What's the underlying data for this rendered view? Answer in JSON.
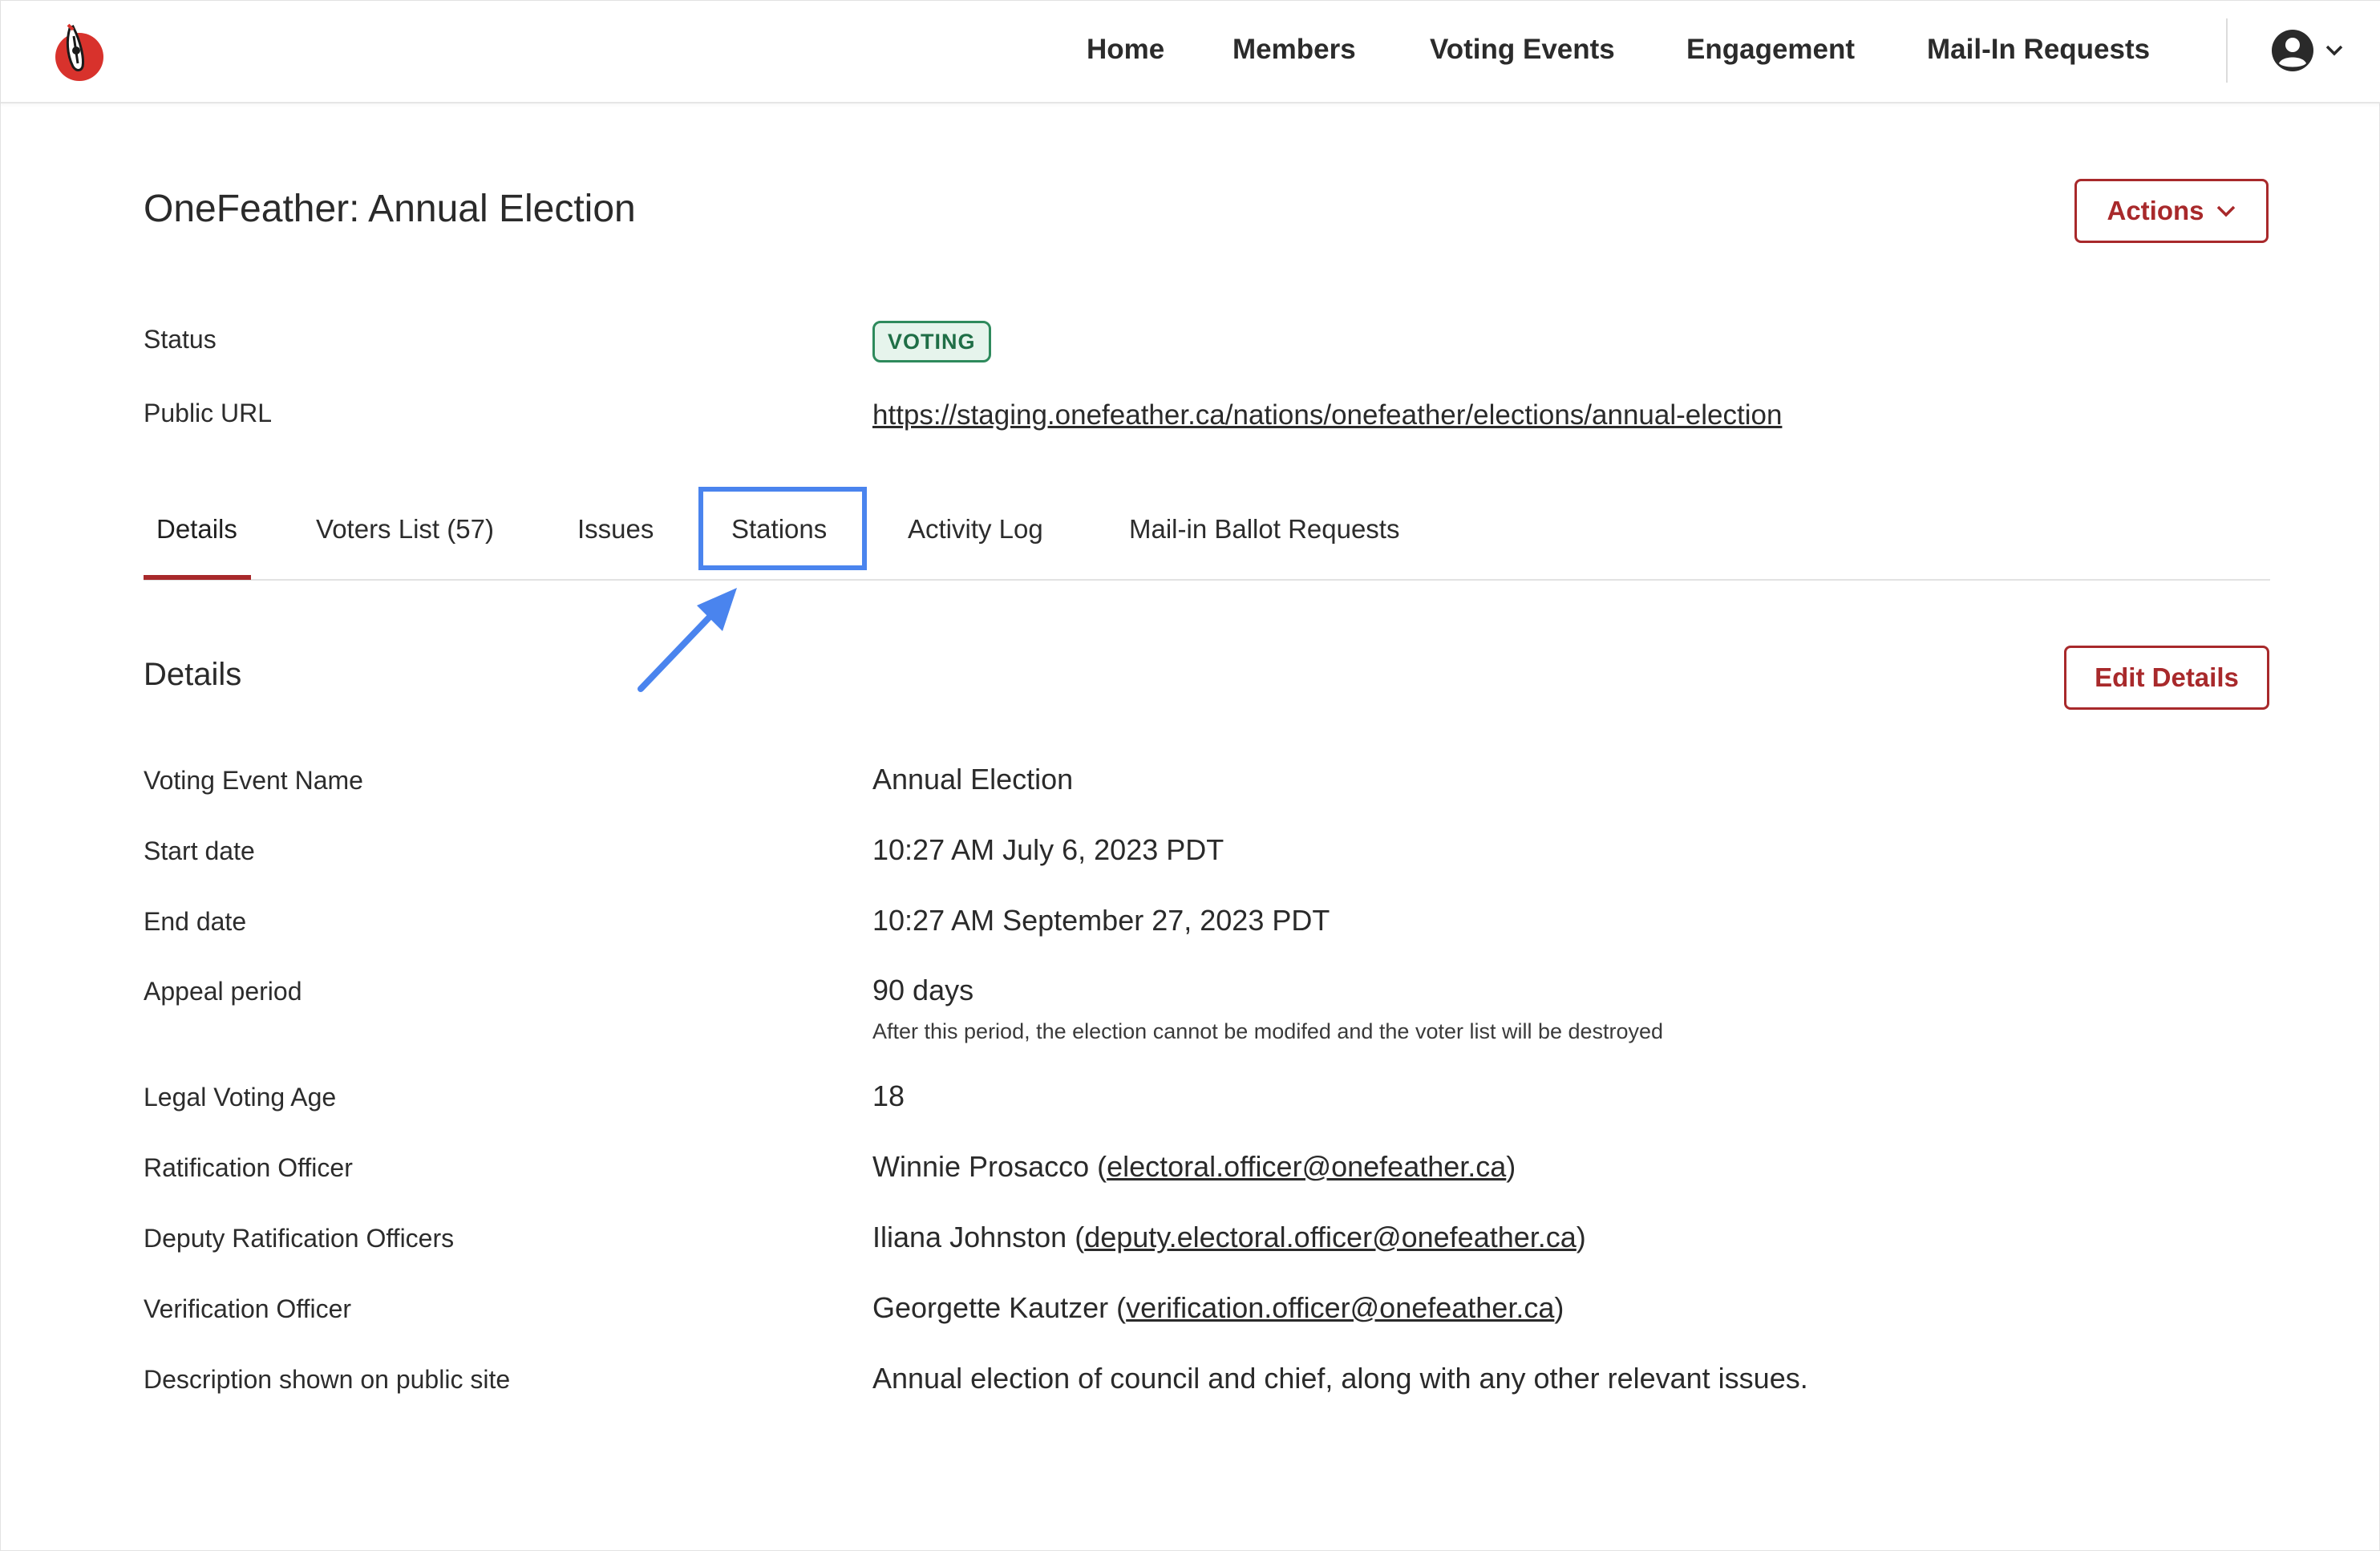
{
  "nav": {
    "items": [
      "Home",
      "Members",
      "Voting Events",
      "Engagement",
      "Mail-In Requests"
    ]
  },
  "header": {
    "title": "OneFeather: Annual Election",
    "actions_label": "Actions"
  },
  "meta": {
    "status_label": "Status",
    "status_value": "VOTING",
    "url_label": "Public URL",
    "url_value": "https://staging.onefeather.ca/nations/onefeather/elections/annual-election"
  },
  "tabs": [
    {
      "label": "Details",
      "active": true
    },
    {
      "label": "Voters List (57)",
      "active": false
    },
    {
      "label": "Issues",
      "active": false
    },
    {
      "label": "Stations",
      "active": false,
      "highlighted": true
    },
    {
      "label": "Activity Log",
      "active": false
    },
    {
      "label": "Mail-in Ballot Requests",
      "active": false
    }
  ],
  "details": {
    "title": "Details",
    "edit_label": "Edit Details",
    "rows": [
      {
        "label": "Voting Event Name",
        "value": "Annual Election"
      },
      {
        "label": "Start date",
        "value": "10:27 AM July 6, 2023 PDT"
      },
      {
        "label": "End date",
        "value": "10:27 AM September 27, 2023 PDT"
      },
      {
        "label": "Appeal period",
        "value": "90 days",
        "note": "After this period, the election cannot be modifed and the voter list will be destroyed"
      },
      {
        "label": "Legal Voting Age",
        "value": "18"
      },
      {
        "label": "Ratification Officer",
        "name": "Winnie Prosacco",
        "email": "electoral.officer@onefeather.ca"
      },
      {
        "label": "Deputy Ratification Officers",
        "name": "Iliana Johnston",
        "email": "deputy.electoral.officer@onefeather.ca"
      },
      {
        "label": "Verification Officer",
        "name": "Georgette Kautzer",
        "email": "verification.officer@onefeather.ca"
      },
      {
        "label": "Description shown on public site",
        "value": "Annual election of council and chief, along with any other relevant issues."
      }
    ]
  },
  "colors": {
    "brand": "#a8292b",
    "voting_badge": "#2e8a5c",
    "highlight": "#4a84ee"
  },
  "icons": {
    "logo": "onefeather-logo-icon",
    "account": "user-circle-icon",
    "chevron": "chevron-down-icon",
    "annotation": "arrow-icon"
  }
}
